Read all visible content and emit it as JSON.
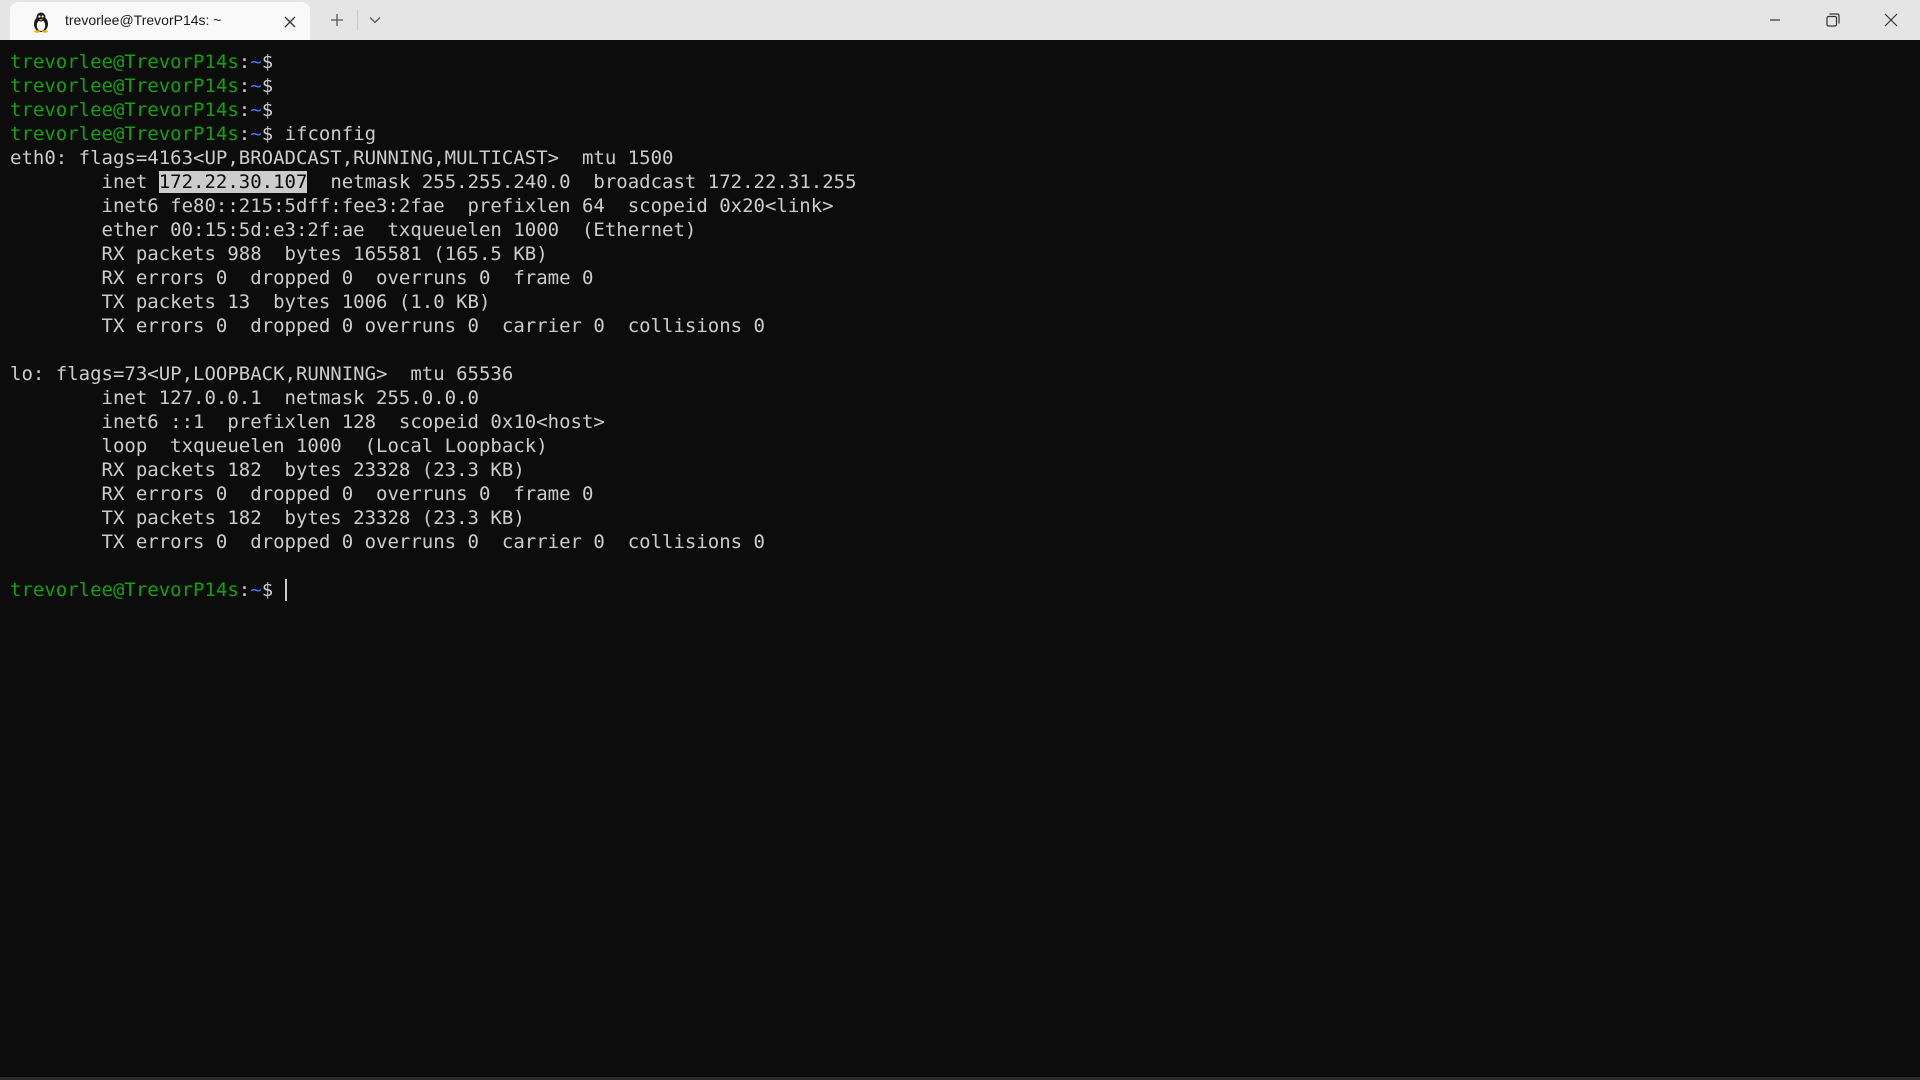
{
  "tab": {
    "title": "trevorlee@TrevorP14s: ~",
    "icon": "linux-tux-icon"
  },
  "colors": {
    "background": "#0c0c0c",
    "text": "#cccccc",
    "prompt_user": "#13a10e",
    "prompt_path": "#3b78ff",
    "tabbar": "#e5e5e5"
  },
  "prompt": {
    "user_host": "trevorlee@TrevorP14s",
    "separator": ":",
    "path": "~",
    "symbol": "$"
  },
  "terminal": {
    "command": " ifconfig",
    "eth0": {
      "header": "eth0: flags=4163<UP,BROADCAST,RUNNING,MULTICAST>  mtu 1500",
      "inet_prefix": "        inet ",
      "inet_ip": "172.22.30.107",
      "inet_suffix": "  netmask 255.255.240.0  broadcast 172.22.31.255",
      "inet6": "        inet6 fe80::215:5dff:fee3:2fae  prefixlen 64  scopeid 0x20<link>",
      "ether": "        ether 00:15:5d:e3:2f:ae  txqueuelen 1000  (Ethernet)",
      "rx_packets": "        RX packets 988  bytes 165581 (165.5 KB)",
      "rx_errors": "        RX errors 0  dropped 0  overruns 0  frame 0",
      "tx_packets": "        TX packets 13  bytes 1006 (1.0 KB)",
      "tx_errors": "        TX errors 0  dropped 0 overruns 0  carrier 0  collisions 0"
    },
    "lo": {
      "header": "lo: flags=73<UP,LOOPBACK,RUNNING>  mtu 65536",
      "inet": "        inet 127.0.0.1  netmask 255.0.0.0",
      "inet6": "        inet6 ::1  prefixlen 128  scopeid 0x10<host>",
      "loop": "        loop  txqueuelen 1000  (Local Loopback)",
      "rx_packets": "        RX packets 182  bytes 23328 (23.3 KB)",
      "rx_errors": "        RX errors 0  dropped 0  overruns 0  frame 0",
      "tx_packets": "        TX packets 182  bytes 23328 (23.3 KB)",
      "tx_errors": "        TX errors 0  dropped 0 overruns 0  carrier 0  collisions 0"
    }
  }
}
